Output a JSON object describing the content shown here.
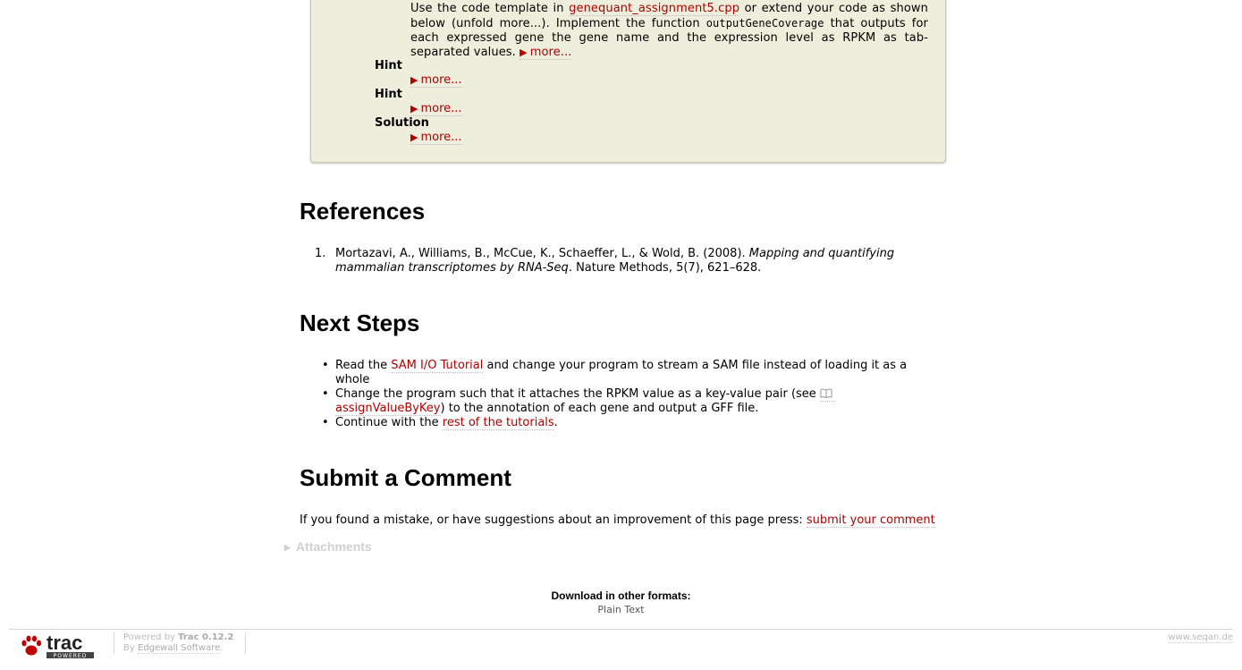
{
  "assignment": {
    "desc_part1": "Use the code template in ",
    "template_link": "genequant_assignment5.cpp",
    "desc_part2": " or extend your code as shown below (unfold more...). Implement the function ",
    "function_name": "outputGeneCoverage",
    "desc_part3": " that outputs for each expressed gene the gene name and the expression level as RPKM as tab-separated values. ",
    "more_label": "more...",
    "hint1_label": "Hint",
    "hint2_label": "Hint",
    "solution_label": "Solution"
  },
  "references": {
    "heading": "References",
    "items": [
      {
        "number": "1.",
        "authors": "Mortazavi, A., Williams, B., McCue, K., Schaeffer, L., & Wold, B. (2008). ",
        "title": "Mapping and quantifying mammalian transcriptomes by RNA-Seq",
        "journal": ". Nature Methods, 5(7), 621–628."
      }
    ]
  },
  "next_steps": {
    "heading": "Next Steps",
    "item1_pre": "Read the ",
    "item1_link": "SAM I/O Tutorial",
    "item1_post": " and change your program to stream a SAM file instead of loading it as a whole",
    "item2_pre": "Change the program such that it attaches the RPKM value as a key-value pair (see ",
    "item2_link": "assignValueByKey",
    "item2_post": ") to the annotation of each gene and output a GFF file.",
    "item3_pre": "Continue with the ",
    "item3_link": "rest of the tutorials",
    "item3_post": "."
  },
  "comment": {
    "heading": "Submit a Comment",
    "text": "If you found a mistake, or have suggestions about an improvement of this page press: ",
    "link": "submit your comment"
  },
  "attachments_label": "Attachments",
  "download": {
    "title": "Download in other formats:",
    "plain_text": "Plain Text"
  },
  "footer": {
    "powered_by": "Powered by ",
    "trac_version": "Trac 0.12.2",
    "by": "By ",
    "edgewall": "Edgewall Software",
    "by_end": ".",
    "logo_text": "trac",
    "logo_sub": "POWERED",
    "site": "www.seqan.de"
  },
  "colors": {
    "link": "#b00000",
    "box_bg": "#eeeedd"
  }
}
